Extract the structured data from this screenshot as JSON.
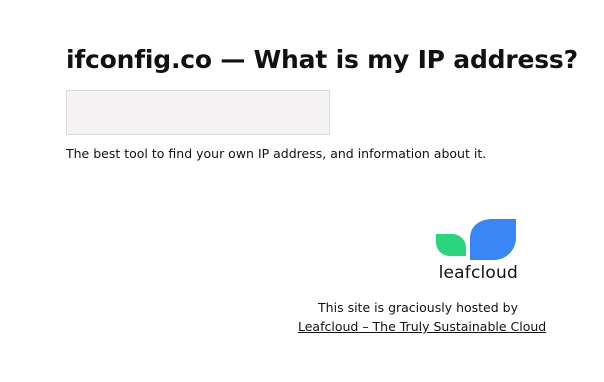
{
  "header": {
    "title": "ifconfig.co — What is my IP address?"
  },
  "ip_box": {
    "value": ""
  },
  "tagline": "The best tool to find your own IP address, and information about it.",
  "sponsor": {
    "logo_text": "leafcloud",
    "logo_icon": "leafcloud-logo-icon",
    "hosted_text": "This site is graciously hosted by",
    "link_text": "Leafcloud – The Truly Sustainable Cloud",
    "colors": {
      "green": "#2bd47f",
      "blue": "#3a86f7"
    }
  }
}
